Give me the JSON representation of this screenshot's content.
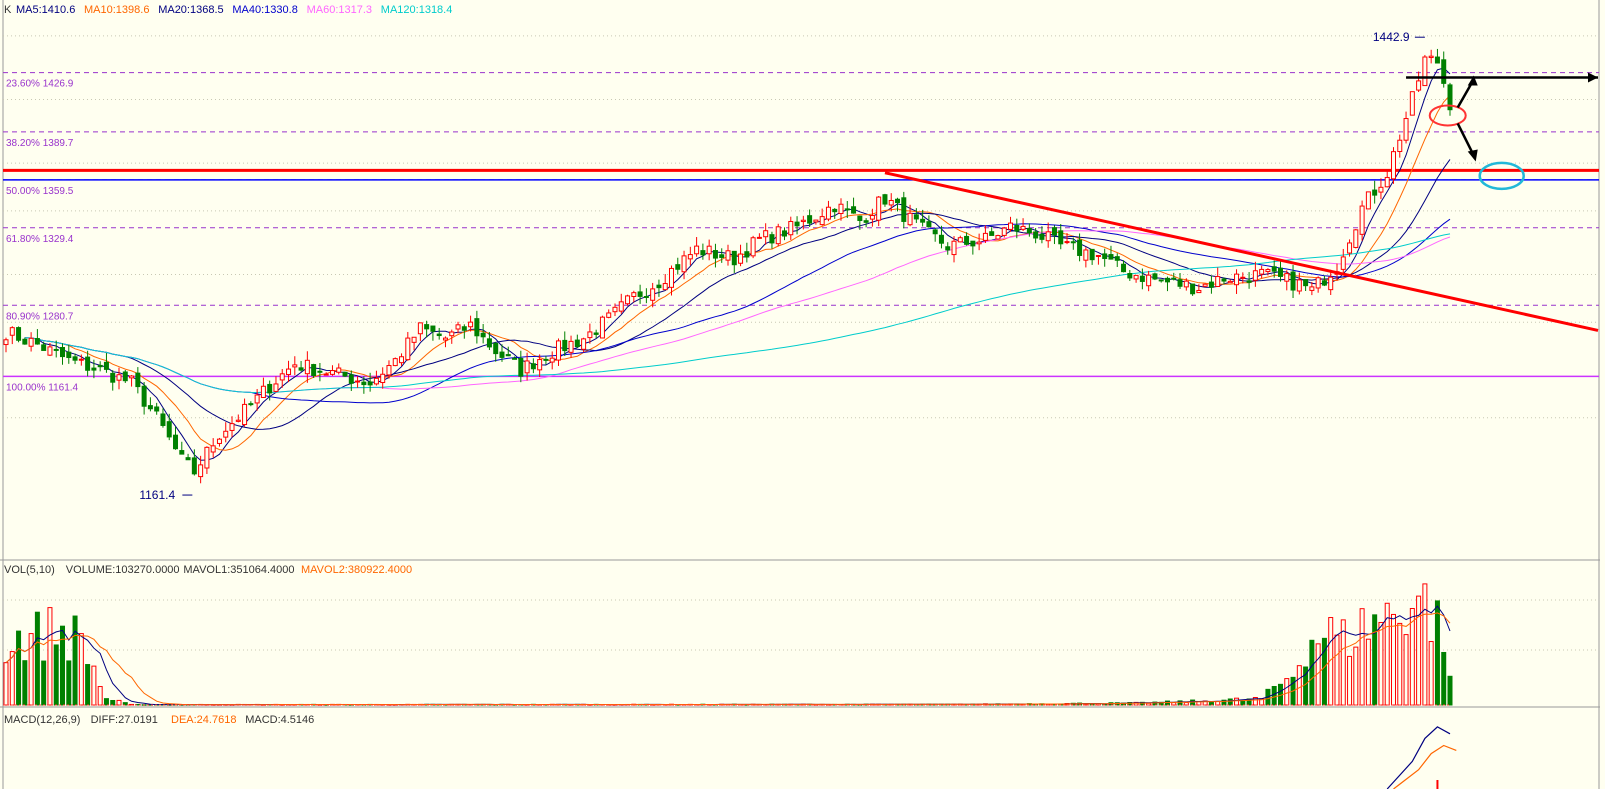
{
  "panels": {
    "main": {
      "indicator_prefix": "K",
      "ma_labels": [
        {
          "text": "MA5:1410.6",
          "color": "#000080"
        },
        {
          "text": "MA10:1398.6",
          "color": "#ff6600"
        },
        {
          "text": "MA20:1368.5",
          "color": "#000080"
        },
        {
          "text": "MA40:1330.8",
          "color": "#0000cc"
        },
        {
          "text": "MA60:1317.3",
          "color": "#ff66ff"
        },
        {
          "text": "MA120:1318.4",
          "color": "#00cccc"
        }
      ]
    },
    "volume": {
      "labels": [
        {
          "text": "VOL(5,10)",
          "color": "#333333"
        },
        {
          "text": "VOLUME:103270.0000",
          "color": "#333333"
        },
        {
          "text": "MAVOL1:351064.4000",
          "color": "#333333"
        },
        {
          "text": "MAVOL2:380922.4000",
          "color": "#ff6600"
        }
      ]
    },
    "macd": {
      "labels": [
        {
          "text": "MACD(12,26,9)",
          "color": "#333333"
        },
        {
          "text": "DIFF:27.0191",
          "color": "#333333"
        },
        {
          "text": "DEA:24.7618",
          "color": "#ff6600"
        },
        {
          "text": "MACD:4.5146",
          "color": "#333333"
        }
      ]
    }
  },
  "chart_data": {
    "type": "candlestick",
    "ylim": [
      1130,
      1460
    ],
    "high_annotation": {
      "text": "1442.9",
      "value": 1442.9
    },
    "low_annotation": {
      "text": "1161.4",
      "value": 1161.4
    },
    "fibonacci_levels": [
      {
        "label": "23.60% 1426.9",
        "value": 1426.9
      },
      {
        "label": "38.20% 1389.7",
        "value": 1389.7
      },
      {
        "label": "50.00% 1359.5",
        "value": 1359.5
      },
      {
        "label": "61.80% 1329.4",
        "value": 1329.4
      },
      {
        "label": "80.90% 1280.7",
        "value": 1280.7
      },
      {
        "label": "100.00% 1161.4",
        "value": 1236
      }
    ],
    "horizontal_lines": [
      {
        "value": 1365.5,
        "color": "#ff0000",
        "style": "solid-thick"
      },
      {
        "value": 1359.5,
        "color": "#0000ff",
        "style": "solid"
      },
      {
        "value": 1236,
        "color": "#cc33ff",
        "style": "solid"
      }
    ],
    "trendline": {
      "color": "#ff0000",
      "from_index": 140,
      "from_value": 1364,
      "to_index": 250,
      "to_value": 1268
    },
    "price_path": [
      [
        0,
        1264
      ],
      [
        5,
        1256
      ],
      [
        10,
        1246
      ],
      [
        15,
        1240
      ],
      [
        20,
        1232
      ],
      [
        24,
        1210
      ],
      [
        28,
        1183
      ],
      [
        30,
        1176
      ],
      [
        34,
        1200
      ],
      [
        38,
        1214
      ],
      [
        42,
        1230
      ],
      [
        46,
        1244
      ],
      [
        52,
        1238
      ],
      [
        58,
        1232
      ],
      [
        62,
        1246
      ],
      [
        66,
        1266
      ],
      [
        70,
        1260
      ],
      [
        74,
        1268
      ],
      [
        78,
        1252
      ],
      [
        82,
        1240
      ],
      [
        86,
        1250
      ],
      [
        92,
        1260
      ],
      [
        96,
        1272
      ],
      [
        100,
        1286
      ],
      [
        104,
        1296
      ],
      [
        110,
        1316
      ],
      [
        116,
        1310
      ],
      [
        120,
        1322
      ],
      [
        126,
        1330
      ],
      [
        132,
        1344
      ],
      [
        136,
        1334
      ],
      [
        140,
        1348
      ],
      [
        146,
        1328
      ],
      [
        150,
        1318
      ],
      [
        156,
        1322
      ],
      [
        160,
        1330
      ],
      [
        164,
        1326
      ],
      [
        168,
        1318
      ],
      [
        174,
        1312
      ],
      [
        178,
        1302
      ],
      [
        184,
        1296
      ],
      [
        190,
        1292
      ],
      [
        194,
        1298
      ],
      [
        200,
        1300
      ],
      [
        206,
        1294
      ],
      [
        208,
        1290
      ],
      [
        212,
        1306
      ],
      [
        216,
        1342
      ],
      [
        220,
        1364
      ],
      [
        224,
        1410
      ],
      [
        226,
        1435
      ],
      [
        228,
        1434
      ],
      [
        230,
        1408
      ]
    ],
    "candles_count": 231,
    "volume_scale_max": 620000,
    "volume_path": [
      [
        0,
        300000
      ],
      [
        5,
        330000
      ],
      [
        8,
        360000
      ],
      [
        12,
        310000
      ],
      [
        16,
        30000
      ],
      [
        20,
        2000
      ],
      [
        150,
        3000
      ],
      [
        180,
        9000
      ],
      [
        190,
        18000
      ],
      [
        200,
        30000
      ],
      [
        205,
        150000
      ],
      [
        207,
        290000
      ],
      [
        210,
        350000
      ],
      [
        213,
        310000
      ],
      [
        216,
        370000
      ],
      [
        219,
        420000
      ],
      [
        221,
        430000
      ],
      [
        223,
        480000
      ],
      [
        225,
        520000
      ],
      [
        227,
        440000
      ],
      [
        229,
        350000
      ],
      [
        230,
        103270
      ]
    ],
    "macd_path": [
      [
        220,
        0
      ],
      [
        224,
        12
      ],
      [
        226,
        22
      ],
      [
        228,
        27
      ],
      [
        230,
        24
      ]
    ]
  }
}
